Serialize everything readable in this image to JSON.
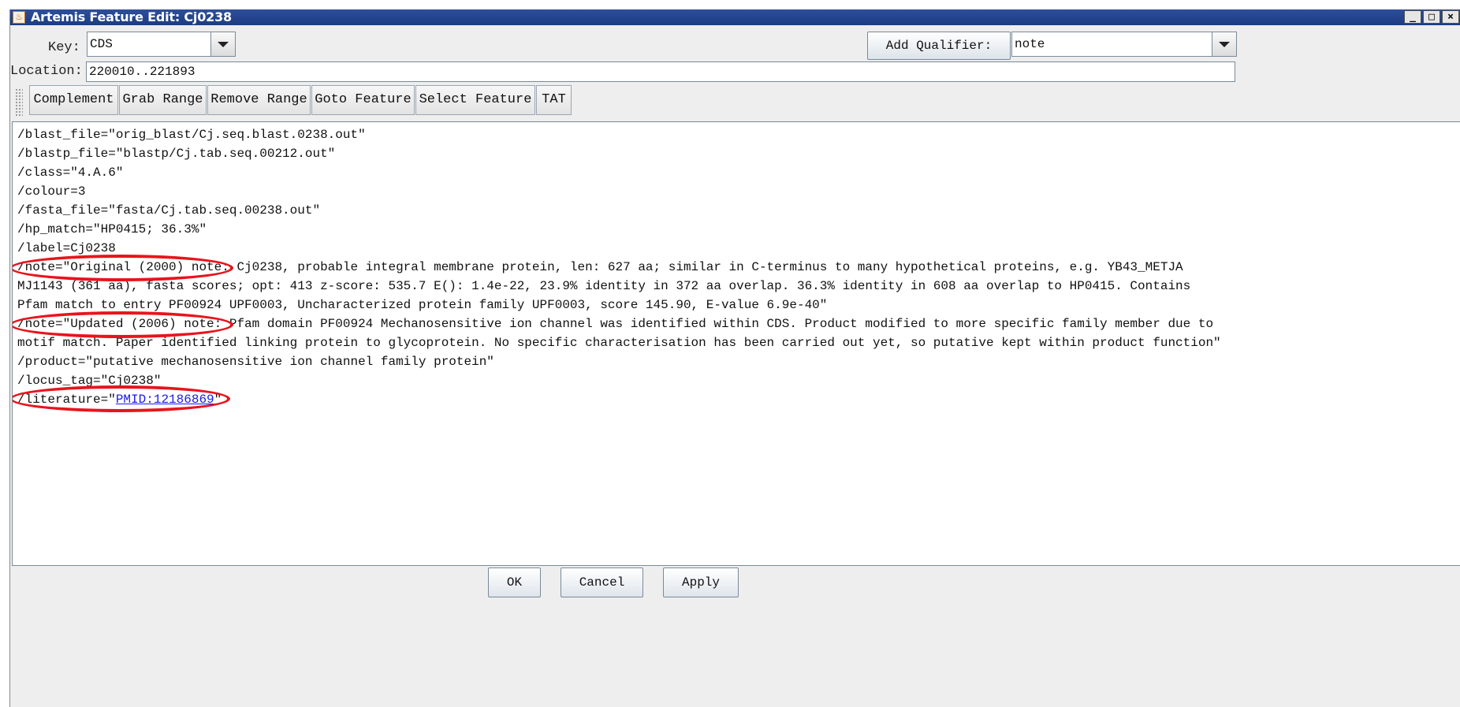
{
  "window": {
    "title": "Artemis Feature Edit: Cj0238",
    "controls": {
      "minimize": "_",
      "maximize": "□",
      "close": "×"
    }
  },
  "key_row": {
    "key_label": "Key:",
    "key_value": "CDS",
    "add_qualifier_label": "Add Qualifier:",
    "qualifier_value": "note"
  },
  "location_row": {
    "label": "Location:",
    "value": "220010..221893"
  },
  "toolbar": {
    "buttons": [
      "Complement",
      "Grab Range",
      "Remove Range",
      "Goto Feature",
      "Select Feature",
      "TAT"
    ]
  },
  "qualifiers": {
    "lines": [
      "/blast_file=\"orig_blast/Cj.seq.blast.0238.out\"",
      "/blastp_file=\"blastp/Cj.tab.seq.00212.out\"",
      "/class=\"4.A.6\"",
      "/colour=3",
      "/fasta_file=\"fasta/Cj.tab.seq.00238.out\"",
      "/hp_match=\"HP0415; 36.3%\"",
      "/label=Cj0238",
      "/note=\"Original (2000) note: Cj0238, probable integral membrane protein, len: 627 aa; similar in C-terminus to many hypothetical proteins, e.g. YB43_METJA",
      "MJ1143 (361 aa), fasta scores; opt: 413 z-score: 535.7 E(): 1.4e-22, 23.9% identity in 372 aa overlap. 36.3% identity in 608 aa overlap to HP0415. Contains",
      "Pfam match to entry PF00924 UPF0003, Uncharacterized protein family UPF0003, score 145.90, E-value 6.9e-40\"",
      "/note=\"Updated (2006) note: Pfam domain PF00924 Mechanosensitive ion channel was identified within CDS. Product modified to more specific family member due to",
      "motif match. Paper identified linking protein to glycoprotein. No specific characterisation has been carried out yet, so putative kept within product function\"",
      "/product=\"putative mechanosensitive ion channel family protein\"",
      "/locus_tag=\"Cj0238\""
    ],
    "literature_prefix": "/literature=\"",
    "literature_link": "PMID:12186869",
    "literature_suffix": "\""
  },
  "buttons": {
    "ok": "OK",
    "cancel": "Cancel",
    "apply": "Apply"
  },
  "colors": {
    "title_bar": "#1c3c82",
    "highlight_circle": "#e8141c",
    "link": "#1a1aee"
  }
}
